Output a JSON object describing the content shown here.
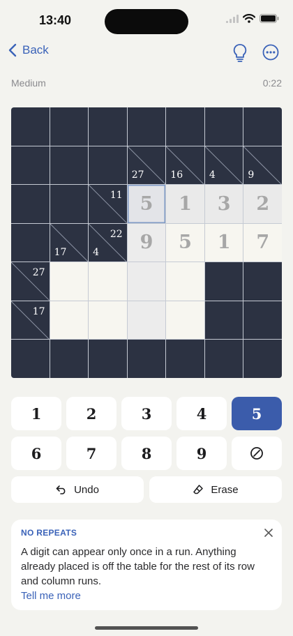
{
  "status_bar": {
    "time": "13:40"
  },
  "nav": {
    "back_label": "Back",
    "hint_icon": "lightbulb-icon",
    "more_icon": "ellipsis-circle-icon"
  },
  "game": {
    "difficulty": "Medium",
    "timer": "0:22"
  },
  "board": {
    "size": 7,
    "cells": [
      [
        {
          "t": "b"
        },
        {
          "t": "b"
        },
        {
          "t": "b"
        },
        {
          "t": "b"
        },
        {
          "t": "b"
        },
        {
          "t": "b"
        },
        {
          "t": "b"
        }
      ],
      [
        {
          "t": "b"
        },
        {
          "t": "b"
        },
        {
          "t": "b"
        },
        {
          "t": "c",
          "down": "27"
        },
        {
          "t": "c",
          "down": "16"
        },
        {
          "t": "c",
          "down": "4"
        },
        {
          "t": "c",
          "down": "9"
        }
      ],
      [
        {
          "t": "b"
        },
        {
          "t": "b"
        },
        {
          "t": "c",
          "right": "11"
        },
        {
          "t": "e",
          "v": "5",
          "state": "selected"
        },
        {
          "t": "e",
          "v": "1",
          "state": "row"
        },
        {
          "t": "e",
          "v": "3",
          "state": "row"
        },
        {
          "t": "e",
          "v": "2",
          "state": "row"
        }
      ],
      [
        {
          "t": "b"
        },
        {
          "t": "c",
          "down": "17"
        },
        {
          "t": "c",
          "down": "4",
          "right": "22"
        },
        {
          "t": "e",
          "v": "9",
          "state": "col"
        },
        {
          "t": "e",
          "v": "5"
        },
        {
          "t": "e",
          "v": "1"
        },
        {
          "t": "e",
          "v": "7"
        }
      ],
      [
        {
          "t": "c",
          "right": "27"
        },
        {
          "t": "e"
        },
        {
          "t": "e"
        },
        {
          "t": "e",
          "state": "col"
        },
        {
          "t": "e"
        },
        {
          "t": "b"
        },
        {
          "t": "b"
        }
      ],
      [
        {
          "t": "c",
          "right": "17"
        },
        {
          "t": "e"
        },
        {
          "t": "e"
        },
        {
          "t": "e",
          "state": "col"
        },
        {
          "t": "e"
        },
        {
          "t": "b"
        },
        {
          "t": "b"
        }
      ],
      [
        {
          "t": "b"
        },
        {
          "t": "b"
        },
        {
          "t": "b"
        },
        {
          "t": "b"
        },
        {
          "t": "b"
        },
        {
          "t": "b"
        },
        {
          "t": "b"
        }
      ]
    ]
  },
  "keypad": {
    "digits": [
      "1",
      "2",
      "3",
      "4",
      "5",
      "6",
      "7",
      "8",
      "9"
    ],
    "active_digit": "5",
    "clear_icon": "clear-cell-icon"
  },
  "actions": {
    "undo_label": "Undo",
    "erase_label": "Erase"
  },
  "tip": {
    "title": "NO REPEATS",
    "body": "A digit can appear only once in a run. Anything already placed is off the table for the rest of its row and column runs.",
    "link": "Tell me more"
  },
  "colors": {
    "accent": "#3b5cab",
    "block": "#2c3242",
    "entry": "#f7f6f0",
    "background": "#f3f3ef"
  }
}
